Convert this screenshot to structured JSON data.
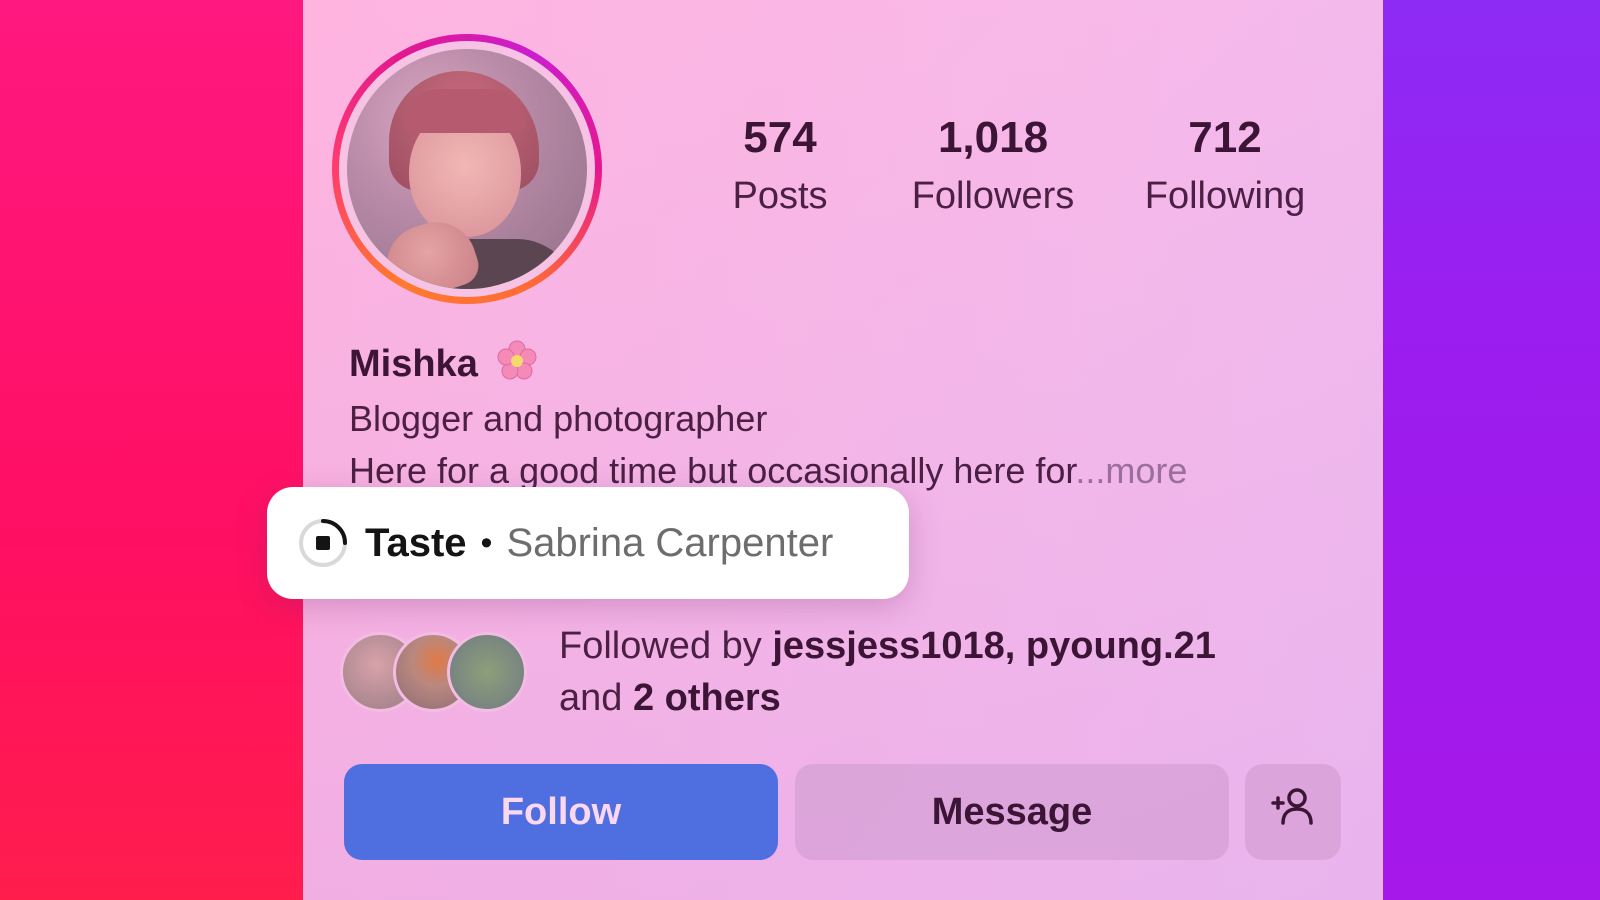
{
  "profile": {
    "name": "Mishka",
    "stats": [
      {
        "value": "574",
        "label": "Posts"
      },
      {
        "value": "1,018",
        "label": "Followers"
      },
      {
        "value": "712",
        "label": "Following"
      }
    ],
    "bio_line1": "Blogger and photographer",
    "bio_line2": "Here for a good time but occasionally here for",
    "bio_more": "...more"
  },
  "music_chip": {
    "title": "Taste",
    "separator": "•",
    "artist": "Sabrina Carpenter",
    "icon": "music-note-icon"
  },
  "followed_by": {
    "prefix": "Followed by",
    "users": "jessjess1018, pyoung.21",
    "and": "and",
    "others": "2 others"
  },
  "actions": {
    "follow_label": "Follow",
    "message_label": "Message",
    "add_user_icon": "add-person-icon"
  },
  "colors": {
    "follow_button": "#4f6fe0",
    "chip_bg": "#ffffff",
    "text_dark": "#3c1436"
  }
}
